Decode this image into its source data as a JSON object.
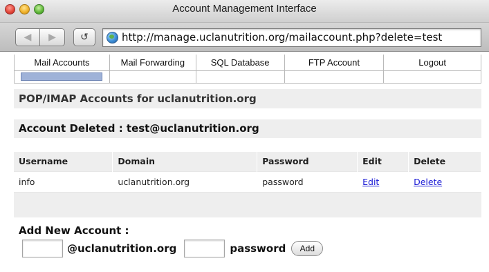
{
  "window": {
    "title": "Account Management Interface"
  },
  "toolbar": {
    "back_icon": "back-arrow-icon",
    "forward_icon": "forward-arrow-icon",
    "reload_icon": "reload-icon",
    "url": "http://manage.uclanutrition.org/mailaccount.php?delete=test"
  },
  "nav": {
    "items": [
      {
        "label": "Mail Accounts",
        "active": true
      },
      {
        "label": "Mail Forwarding",
        "active": false
      },
      {
        "label": "SQL Database",
        "active": false
      },
      {
        "label": "FTP Account",
        "active": false
      },
      {
        "label": "Logout",
        "active": false
      }
    ]
  },
  "section": {
    "title": "POP/IMAP Accounts for uclanutrition.org"
  },
  "status": {
    "message": "Account Deleted : test@uclanutrition.org"
  },
  "accounts": {
    "headers": [
      "Username",
      "Domain",
      "Password",
      "Edit",
      "Delete"
    ],
    "rows": [
      {
        "username": "info",
        "domain": "uclanutrition.org",
        "password": "password",
        "edit": "Edit",
        "delete": "Delete"
      }
    ]
  },
  "add_account": {
    "title": "Add New Account :",
    "username_value": "",
    "domain_suffix": "@uclanutrition.org",
    "password_value": "",
    "password_label": "password",
    "button_label": "Add"
  },
  "colors": {
    "link": "#1b1bd6",
    "band": "#eeeeee",
    "active_tab": "#9fb2d8"
  }
}
